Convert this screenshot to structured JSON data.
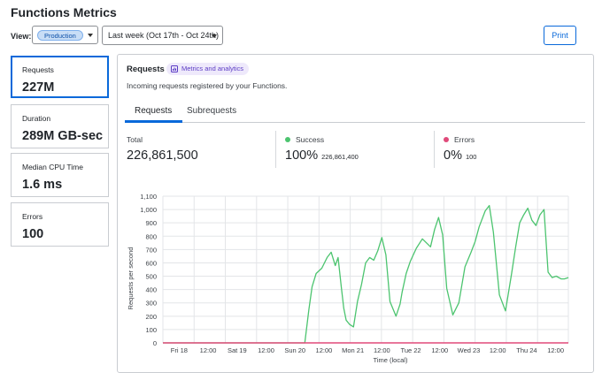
{
  "page": {
    "title": "Functions Metrics"
  },
  "filters": {
    "view_label": "View:",
    "view_value": "Production",
    "range_value": "Last week (Oct 17th - Oct 24th)",
    "print_label": "Print"
  },
  "metrics": [
    {
      "label": "Requests",
      "value": "227M",
      "selected": true
    },
    {
      "label": "Duration",
      "value": "289M GB-sec",
      "selected": false
    },
    {
      "label": "Median CPU Time",
      "value": "1.6 ms",
      "selected": false
    },
    {
      "label": "Errors",
      "value": "100",
      "selected": false
    }
  ],
  "panel": {
    "title": "Requests",
    "badge": "Metrics and analytics",
    "subtitle": "Incoming requests registered by your Functions.",
    "tabs": [
      {
        "label": "Requests",
        "active": true
      },
      {
        "label": "Subrequests",
        "active": false
      }
    ],
    "stats": {
      "total_label": "Total",
      "total_value": "226,861,500",
      "success_label": "Success",
      "success_value": "100%",
      "success_count": "226,861,400",
      "errors_label": "Errors",
      "errors_value": "0%",
      "errors_count": "100"
    }
  },
  "colors": {
    "accent": "#0969da",
    "success": "#4cc46f",
    "error": "#e04a7a"
  },
  "chart_data": {
    "type": "line",
    "xlabel": "Time (local)",
    "ylabel": "Requests per second",
    "ylim": [
      0,
      1100
    ],
    "yticks": [
      0,
      100,
      200,
      300,
      400,
      500,
      600,
      700,
      800,
      900,
      1000,
      1100
    ],
    "ytick_labels": [
      "0",
      "100",
      "200",
      "300",
      "400",
      "500",
      "600",
      "700",
      "800",
      "900",
      "1,000",
      "1,100"
    ],
    "xlim": [
      0,
      1
    ],
    "xticks": [
      0.035,
      0.112,
      0.189,
      0.266,
      0.343,
      0.42,
      0.497,
      0.574,
      0.651,
      0.728,
      0.805,
      0.882,
      0.959
    ],
    "xtick_labels": [
      "Fri 18",
      "12:00",
      "Sat 19",
      "12:00",
      "Sun 20",
      "12:00",
      "Mon 21",
      "12:00",
      "Tue 22",
      "12:00",
      "Wed 23",
      "12:00",
      "Thu 24",
      "12:00"
    ],
    "grid": true,
    "series": [
      {
        "name": "Success",
        "color": "#4cc46f",
        "x": [
          0.0,
          0.35,
          0.36,
          0.368,
          0.378,
          0.392,
          0.405,
          0.415,
          0.425,
          0.432,
          0.44,
          0.446,
          0.452,
          0.46,
          0.47,
          0.48,
          0.49,
          0.5,
          0.51,
          0.52,
          0.53,
          0.54,
          0.55,
          0.56,
          0.575,
          0.585,
          0.59,
          0.6,
          0.61,
          0.625,
          0.64,
          0.66,
          0.67,
          0.68,
          0.69,
          0.7,
          0.715,
          0.73,
          0.745,
          0.76,
          0.77,
          0.78,
          0.785,
          0.795,
          0.805,
          0.815,
          0.83,
          0.845,
          0.86,
          0.87,
          0.88,
          0.89,
          0.9,
          0.91,
          0.92,
          0.93,
          0.94,
          0.95,
          0.96,
          0.97,
          0.982,
          0.99,
          1.0
        ],
        "y": [
          0,
          0,
          250,
          420,
          520,
          560,
          640,
          680,
          580,
          640,
          420,
          260,
          170,
          140,
          120,
          310,
          440,
          600,
          640,
          620,
          690,
          790,
          660,
          310,
          200,
          290,
          380,
          520,
          610,
          710,
          780,
          720,
          850,
          940,
          810,
          410,
          210,
          300,
          570,
          680,
          760,
          870,
          910,
          990,
          1030,
          830,
          360,
          240,
          520,
          720,
          900,
          960,
          1010,
          920,
          880,
          960,
          1000,
          530,
          490,
          500,
          480,
          480,
          490
        ]
      },
      {
        "name": "Errors",
        "color": "#e04a7a",
        "x": [
          0.0,
          1.0
        ],
        "y": [
          0,
          0
        ]
      }
    ]
  }
}
